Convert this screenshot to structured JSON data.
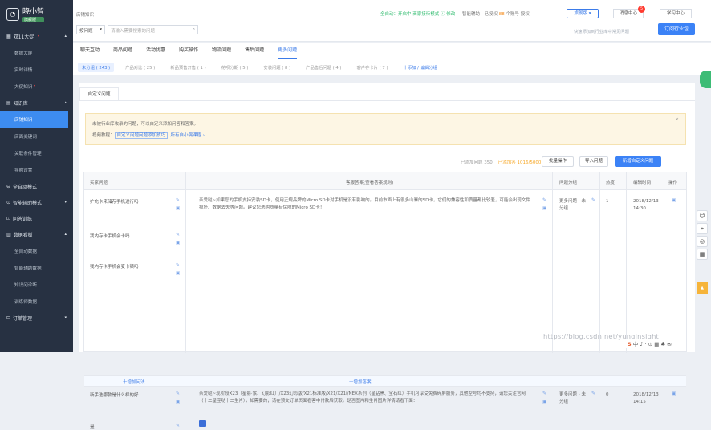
{
  "brand": {
    "name": "晓小智",
    "edition": "旗舰版"
  },
  "sidebar": {
    "g1": "双11大促",
    "g2": "知识库",
    "g3": "全自动模式",
    "g4": "智能辅助模式",
    "g5": "问答训练",
    "g6": "数据看板",
    "g7": "订单管理",
    "items_a": [
      "数据大屏",
      "实时详情",
      "大促知识"
    ],
    "items_b": [
      "店铺知识",
      "店面关键词",
      "关联条件管理",
      "导购设置"
    ],
    "items_c": [
      "全自动数据",
      "智能辅助数据",
      "知识问诊断",
      "训练师数据"
    ]
  },
  "top": {
    "breadcrumb": "店铺知识",
    "select": "按问题",
    "search_placeholder": "请输入需要搜索的问题",
    "status": "全自动：开启中 商家接待模式 ⓘ 修改",
    "status_assist_label": "智能辅助：已授权",
    "status_assist_count": "88",
    "status_assist_tail": "个账号 授权",
    "version": "旗舰版 ▾",
    "messages": "消息中心",
    "badge": "5",
    "learn": "学习中心",
    "hint": "快速添加到行业库中常见问题",
    "order": "订阅行业包"
  },
  "tabs": [
    "聊天互动",
    "商品问题",
    "活动优惠",
    "购买操作",
    "物流问题",
    "售后问题",
    "更多问题"
  ],
  "chips": [
    "未分组 ( 243 )",
    "产品对比 ( 25 )",
    "新品预售开售 ( 1 )",
    "花呗分期 ( 5 )",
    "安装问题 ( 8 )",
    "产品售后问题 ( 4 )",
    "客户存卡片 ( 7 )",
    "十添加 / 编辑分组"
  ],
  "panel": {
    "tab": "自定义问题",
    "notice1": "未被行业库收录的问题，可以自定义添加问答和答案。",
    "notice2_label": "视频教程：",
    "notice2_link": "自定义问题问题添加技巧",
    "notice2_more": "所有自小偶课程 ›",
    "added": "已添加问题 350",
    "added2": "已添加答 1016/5000",
    "btn_batch": "批量操作",
    "btn_import": "导入问题",
    "btn_new": "新增自定义问题"
  },
  "table": {
    "h_question": "买家问题",
    "h_answer": "客服答案(查看答案规则)",
    "h_group": "问题分组",
    "h_ratio": "热度",
    "h_time": "编辑时间",
    "h_op": "操作",
    "r1_q1": "扩充卡来储存手机进行吗",
    "r1_q2": "我内存卡手机会卡吗",
    "r1_q3": "我内存卡手机会变卡顿吗",
    "r1_answer": "亲爱哒~如果您的手机支持安装SD卡，使用正规品牌的Micro SD卡对手机是没有影响的。目前市面上有很多山寨的SD卡，它们的兼容性和质量都比较差，可能会出现文件损坏、数据丢失等问题。建议您选购质量有保障的Micro SD卡！",
    "r1_group": "更多问题 - 未分组",
    "r1_ratio": "1",
    "r1_time": "2018/12/13 14:30",
    "add_q": "十增加问法",
    "add_a": "十增加答案",
    "r2_q1": "新手选哪款是什么样的好",
    "r2_q2": "是",
    "r2_answer": "亲爱哒~现阶段X23（星影·紫、幻影红）/X23幻彩版/X21标准版/X21/X21i/NEX系列（星钻黑、宝石红）手机可享受免费碎屏服务，其他型号均不支持，请您关注官网（十二星座哒十二生肖），如需要的，请在预交订单页面看客中付款后获取。是否图片和生肖图片详情请看下面：",
    "r2_group": "更多问题 - 未分组",
    "r2_ratio": "0",
    "r2_time": "2018/12/13 14:15"
  },
  "watermark": "https://blog.csdn.net/yunqinsight",
  "ime": "中 ♪ · ⊙ ▦ ♣ ✉",
  "colors": {
    "primary": "#3b82f6",
    "sidebar": "#273142",
    "active": "#3d8cf0",
    "warning_bg": "#fdf6e4"
  }
}
